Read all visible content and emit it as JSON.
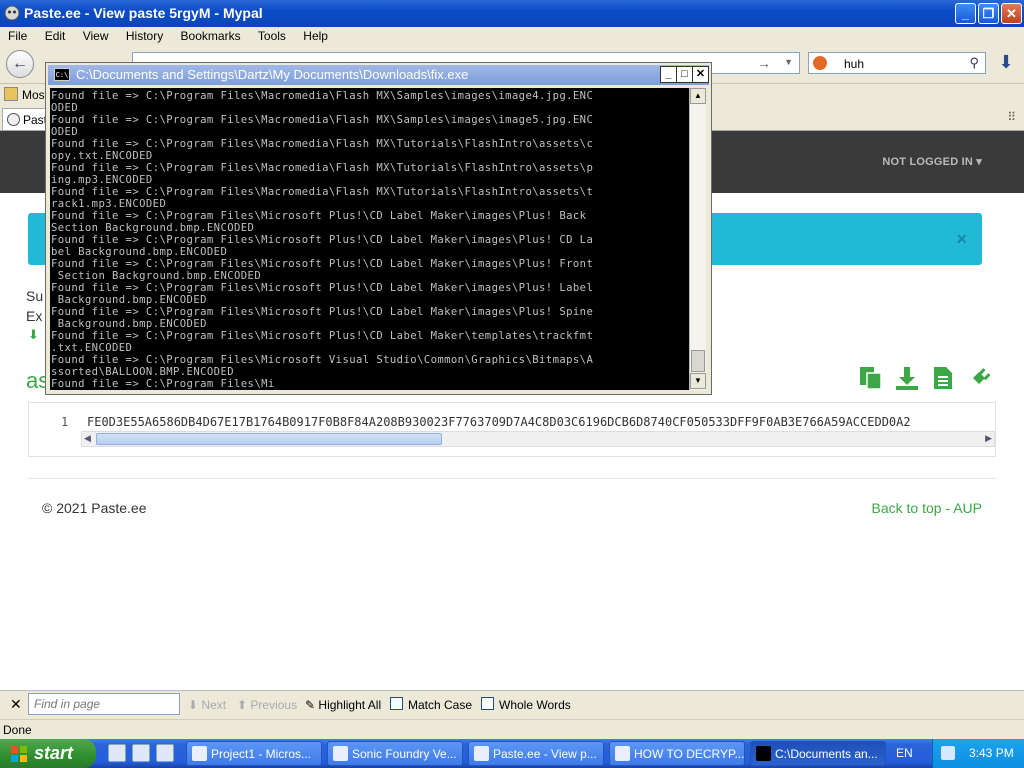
{
  "browser": {
    "title": "Paste.ee - View paste 5rgyM - Mypal",
    "menu": [
      "File",
      "Edit",
      "View",
      "History",
      "Bookmarks",
      "Tools",
      "Help"
    ],
    "search_value": "huh",
    "bookmark_label": "Most",
    "tab_label": "Past"
  },
  "page": {
    "not_logged_in": "NOT LOGGED IN",
    "meta_1": "Su",
    "meta_2": "Ex",
    "title_frag": "as",
    "line_number": "1",
    "code_line": "FE0D3E55A6586DB4D67E17B1764B0917F0B8F84A208B930023F7763709D7A4C8D03C6196DCB6D8740CF050533DFF9F0AB3E766A59ACCEDD0A2",
    "copyright": "© 2021 Paste.ee",
    "back_to_top": "Back to top",
    "separator": " - ",
    "aup": "AUP"
  },
  "console": {
    "title": "C:\\Documents and Settings\\Dartz\\My Documents\\Downloads\\fix.exe",
    "lines": [
      "Found file => C:\\Program Files\\Macromedia\\Flash MX\\Samples\\images\\image4.jpg.ENC",
      "ODED",
      "Found file => C:\\Program Files\\Macromedia\\Flash MX\\Samples\\images\\image5.jpg.ENC",
      "ODED",
      "Found file => C:\\Program Files\\Macromedia\\Flash MX\\Tutorials\\FlashIntro\\assets\\c",
      "opy.txt.ENCODED",
      "Found file => C:\\Program Files\\Macromedia\\Flash MX\\Tutorials\\FlashIntro\\assets\\p",
      "ing.mp3.ENCODED",
      "Found file => C:\\Program Files\\Macromedia\\Flash MX\\Tutorials\\FlashIntro\\assets\\t",
      "rack1.mp3.ENCODED",
      "Found file => C:\\Program Files\\Microsoft Plus!\\CD Label Maker\\images\\Plus! Back",
      "Section Background.bmp.ENCODED",
      "Found file => C:\\Program Files\\Microsoft Plus!\\CD Label Maker\\images\\Plus! CD La",
      "bel Background.bmp.ENCODED",
      "Found file => C:\\Program Files\\Microsoft Plus!\\CD Label Maker\\images\\Plus! Front",
      " Section Background.bmp.ENCODED",
      "Found file => C:\\Program Files\\Microsoft Plus!\\CD Label Maker\\images\\Plus! Label",
      " Background.bmp.ENCODED",
      "Found file => C:\\Program Files\\Microsoft Plus!\\CD Label Maker\\images\\Plus! Spine",
      " Background.bmp.ENCODED",
      "Found file => C:\\Program Files\\Microsoft Plus!\\CD Label Maker\\templates\\trackfmt",
      ".txt.ENCODED",
      "Found file => C:\\Program Files\\Microsoft Visual Studio\\Common\\Graphics\\Bitmaps\\A",
      "ssorted\\BALLOON.BMP.ENCODED",
      "Found file => C:\\Program Files\\Mi"
    ]
  },
  "findbar": {
    "placeholder": "Find in page",
    "next": "Next",
    "previous": "Previous",
    "highlight_all": "Highlight All",
    "match_case": "Match Case",
    "whole_words": "Whole Words"
  },
  "status": "Done",
  "taskbar": {
    "start": "start",
    "items": [
      "Project1 - Micros...",
      "Sonic Foundry Ve...",
      "Paste.ee - View p...",
      "HOW TO DECRYP...",
      "C:\\Documents an..."
    ],
    "lang": "EN",
    "time": "3:43 PM"
  },
  "colors": {
    "accent_green": "#3ca745",
    "alert_blue": "#22b8d8",
    "header_dark": "#3a3a3a"
  }
}
